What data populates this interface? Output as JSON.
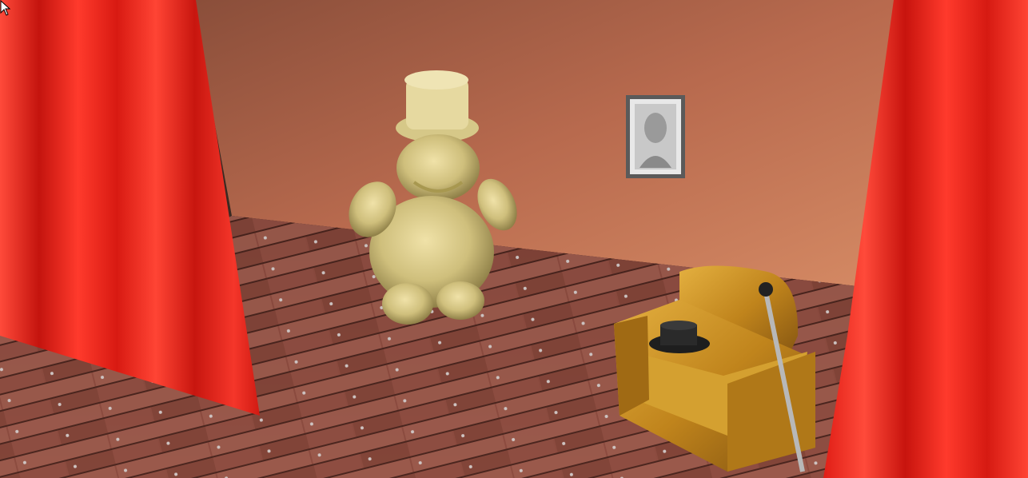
{
  "scene": {
    "type": "3d-game-viewport",
    "objects": [
      "left-red-curtain",
      "right-red-curtain",
      "back-wall",
      "wooden-plank-floor",
      "framed-portrait",
      "gold-figure-with-top-hat",
      "golden-armchair",
      "black-top-hat",
      "walking-cane"
    ]
  },
  "colors": {
    "curtain": "#e8241c",
    "wall": "#b86a4e",
    "floor": "#8a4a3e",
    "figure": "#d8c888",
    "armchair": "#c8921e",
    "hat": "#2a2a2a"
  },
  "cursor": {
    "icon": "mouse-pointer-icon"
  }
}
